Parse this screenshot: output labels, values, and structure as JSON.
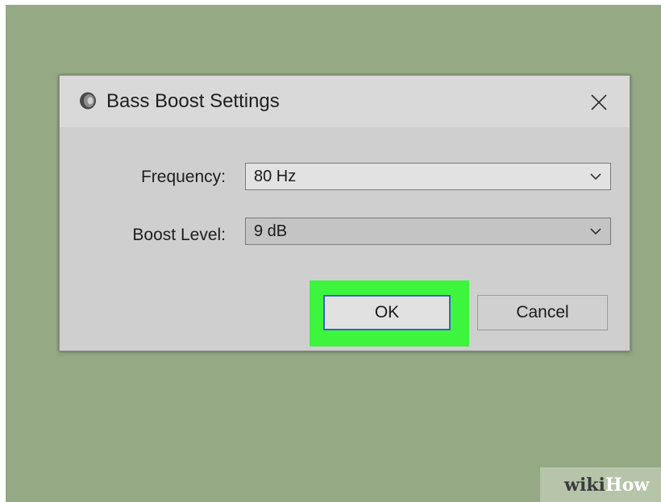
{
  "dialog": {
    "title": "Bass Boost Settings",
    "app_icon": "speaker-icon",
    "close_icon": "close-icon"
  },
  "fields": {
    "frequency": {
      "label": "Frequency:",
      "value": "80 Hz"
    },
    "boost_level": {
      "label": "Boost Level:",
      "value": "9 dB"
    }
  },
  "buttons": {
    "ok_label": "OK",
    "cancel_label": "Cancel"
  },
  "highlight_color": "#3ef53e",
  "watermark": {
    "part1": "wiki",
    "part2": "How"
  }
}
